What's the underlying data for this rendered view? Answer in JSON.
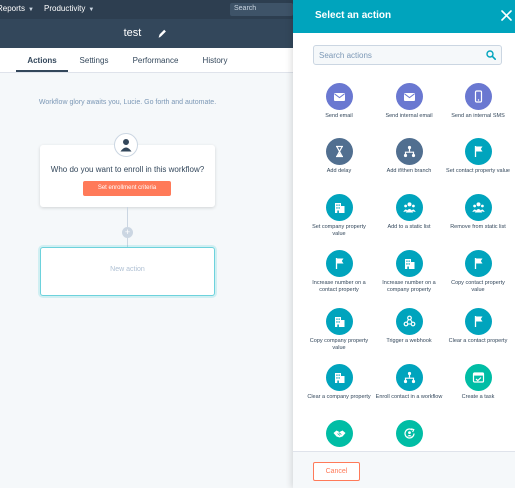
{
  "topnav": {
    "items": [
      {
        "label": "Reports"
      },
      {
        "label": "Productivity"
      }
    ],
    "search_placeholder": "Search"
  },
  "header": {
    "title": "test"
  },
  "tabs": [
    {
      "label": "Actions",
      "active": true
    },
    {
      "label": "Settings",
      "active": false
    },
    {
      "label": "Performance",
      "active": false
    },
    {
      "label": "History",
      "active": false
    }
  ],
  "canvas": {
    "welcome": "Workflow glory awaits you, Lucie. Go forth and automate.",
    "trigger_question": "Who do you want to enroll in this workflow?",
    "enrollment_button": "Set enrollment criteria",
    "new_action": "New action"
  },
  "panel": {
    "title": "Select an action",
    "search_placeholder": "Search actions",
    "cancel": "Cancel",
    "actions": [
      {
        "label": "Send email",
        "icon": "envelope-icon",
        "color": "#6a78d1"
      },
      {
        "label": "Send internal email",
        "icon": "envelope-icon",
        "color": "#6a78d1"
      },
      {
        "label": "Send an internal SMS",
        "icon": "mobile-phone-icon",
        "color": "#6a78d1"
      },
      {
        "label": "Add delay",
        "icon": "hourglass-icon",
        "color": "#516f90"
      },
      {
        "label": "Add if/then branch",
        "icon": "branch-icon",
        "color": "#516f90"
      },
      {
        "label": "Set contact property value",
        "icon": "flag-icon",
        "color": "#00a4bd"
      },
      {
        "label": "Set company property value",
        "icon": "building-icon",
        "color": "#00a4bd"
      },
      {
        "label": "Add to a static list",
        "icon": "people-icon",
        "color": "#00a4bd"
      },
      {
        "label": "Remove from static list",
        "icon": "people-icon",
        "color": "#00a4bd"
      },
      {
        "label": "Increase number on a contact property",
        "icon": "flag-icon",
        "color": "#00a4bd"
      },
      {
        "label": "Increase number on a company property",
        "icon": "building-icon",
        "color": "#00a4bd"
      },
      {
        "label": "Copy contact property value",
        "icon": "flag-icon",
        "color": "#00a4bd"
      },
      {
        "label": "Copy company property value",
        "icon": "building-icon",
        "color": "#00a4bd"
      },
      {
        "label": "Trigger a webhook",
        "icon": "webhook-icon",
        "color": "#00a4bd"
      },
      {
        "label": "Clear a contact property",
        "icon": "flag-icon",
        "color": "#00a4bd"
      },
      {
        "label": "Clear a company property",
        "icon": "building-icon",
        "color": "#00a4bd"
      },
      {
        "label": "Enroll contact in a workflow",
        "icon": "branch-icon",
        "color": "#00a4bd"
      },
      {
        "label": "Create a task",
        "icon": "task-icon",
        "color": "#00bda5"
      },
      {
        "label": "",
        "icon": "handshake-icon",
        "color": "#00bda5"
      },
      {
        "label": "",
        "icon": "user-rotate-icon",
        "color": "#00bda5"
      }
    ]
  },
  "colors": {
    "topnav": "#2d3e50",
    "header": "#33475b",
    "panel_header": "#00a4bd",
    "accent_orange": "#ff7a59"
  }
}
